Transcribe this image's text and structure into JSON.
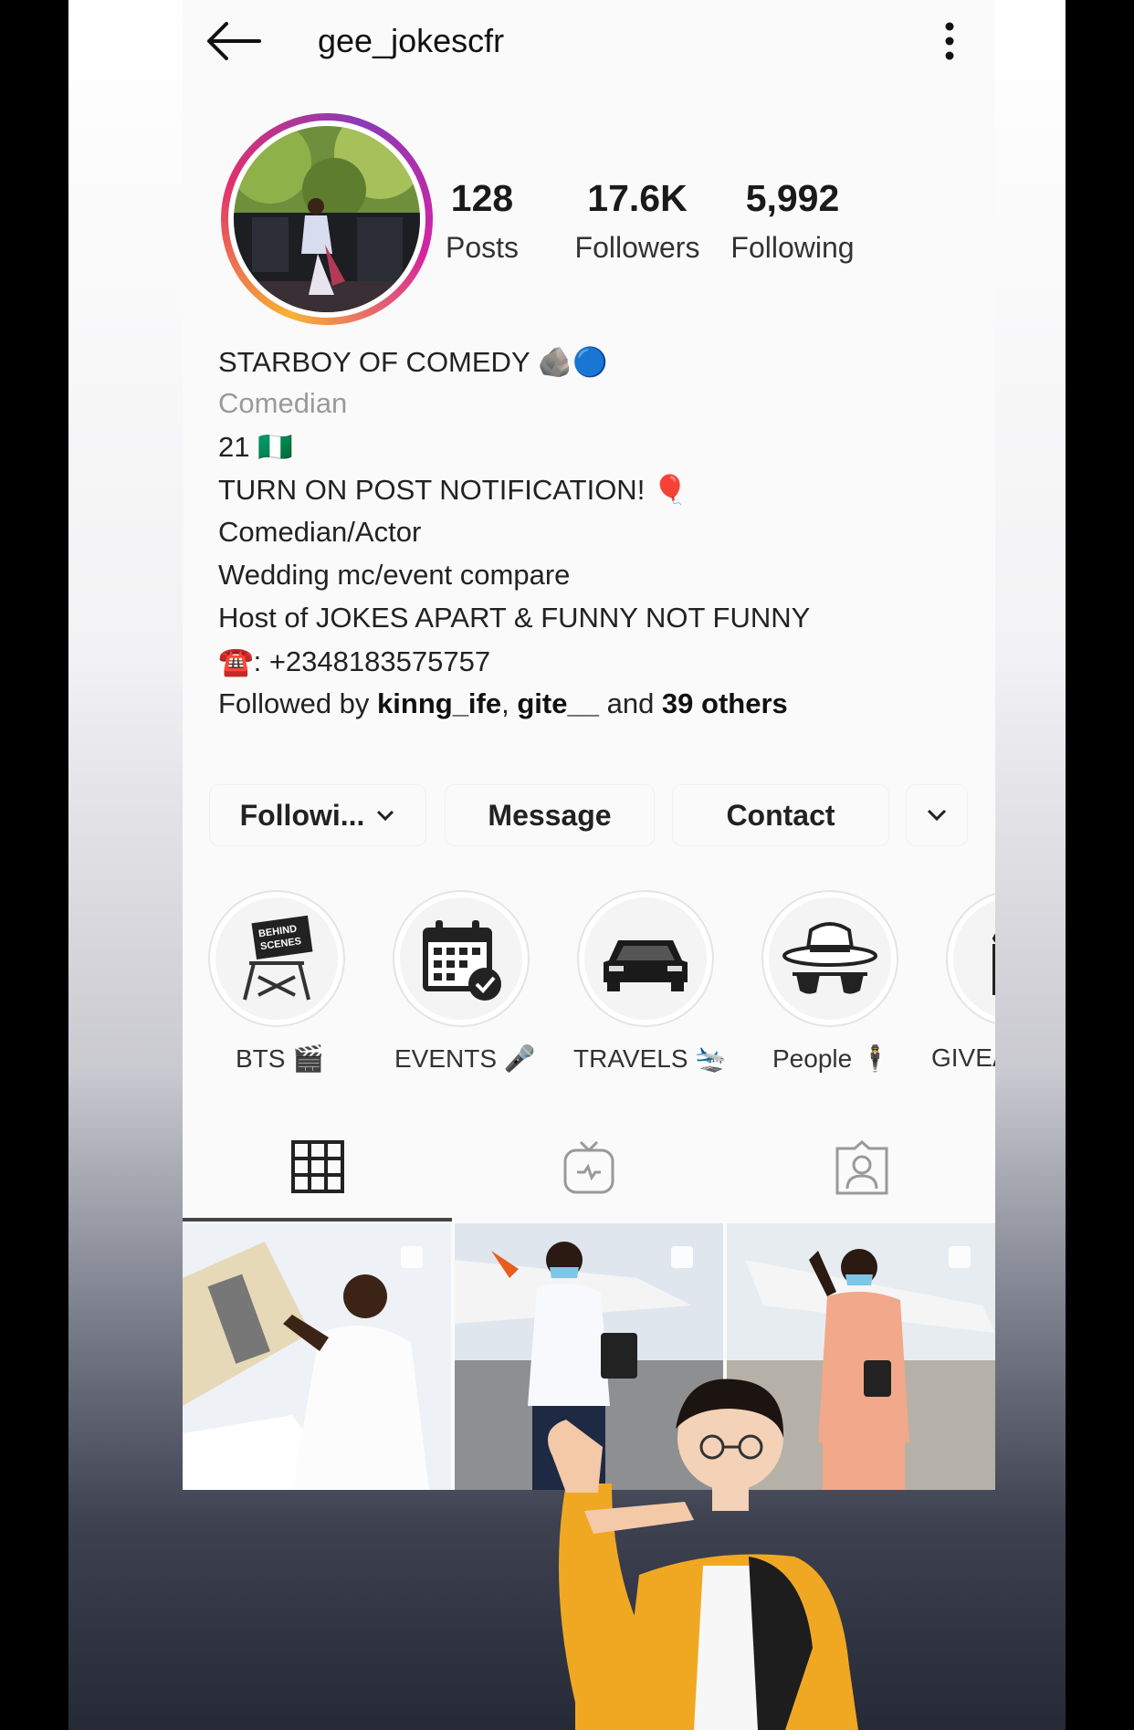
{
  "profile": {
    "username": "gee_jokescfr",
    "stats": [
      {
        "value": "128",
        "label": "Posts"
      },
      {
        "value": "17.6K",
        "label": "Followers"
      },
      {
        "value": "5,992",
        "label": "Following"
      }
    ],
    "name": "STARBOY OF COMEDY",
    "name_emojis": "🪨🔵",
    "category": "Comedian",
    "bio_lines": [
      "21 🇳🇬",
      "TURN ON POST NOTIFICATION! 🎈",
      "Comedian/Actor",
      "Wedding mc/event compare",
      "Host of JOKES APART & FUNNY NOT FUNNY",
      "☎️: +2348183575757"
    ],
    "followed_by": {
      "prefix": "Followed by ",
      "user1": "kinng_ife",
      "sep": ", ",
      "user2": "gite__",
      "mid": " and ",
      "others": "39 others"
    }
  },
  "buttons": {
    "following": "Followi...",
    "message": "Message",
    "contact": "Contact"
  },
  "highlights": [
    {
      "label": "BTS 🎬",
      "icon": "director-chair-icon",
      "caption": "BEHIND SCENES"
    },
    {
      "label": "EVENTS 🎤",
      "icon": "calendar-check-icon"
    },
    {
      "label": "TRAVELS 🛬",
      "icon": "car-icon"
    },
    {
      "label": "People 🕴",
      "icon": "hat-sunglasses-icon"
    },
    {
      "label": "GIVEA",
      "icon": "gift-icon"
    }
  ],
  "tabs": [
    {
      "name": "grid",
      "icon": "grid-icon",
      "active": true
    },
    {
      "name": "igtv",
      "icon": "igtv-icon",
      "active": false
    },
    {
      "name": "tagged",
      "icon": "tagged-person-icon",
      "active": false
    }
  ],
  "colors": {
    "ring_start": "#f7b233",
    "ring_mid": "#e1306c",
    "ring_end": "#8a3ab9",
    "verified": "#3897f0",
    "jacket": "#f0a823"
  }
}
